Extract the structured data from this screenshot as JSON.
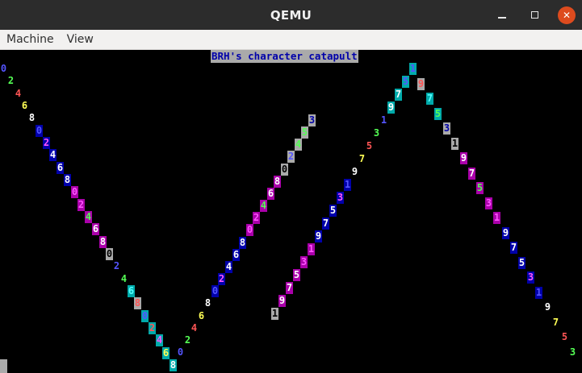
{
  "window": {
    "title": "QEMU",
    "controls": [
      "minimize-icon",
      "maximize-icon",
      "close-icon"
    ]
  },
  "menu": [
    "Machine",
    "View"
  ],
  "screen": {
    "banner": "BRH's character catapult",
    "palette": {
      "blue": "#5555ff",
      "green": "#55ff55",
      "red": "#ff5555",
      "yellow": "#ffff55",
      "white": "#ffffff",
      "darkblue_bg": "#0000aa",
      "magenta_bg": "#aa00aa",
      "cyan_bg": "#00aaaa",
      "gray_bg": "#aaaaaa",
      "magenta_fg": "#ff55ff",
      "cyan_fg": "#55ffff"
    },
    "glyphs": [
      {
        "c": "0",
        "fg": "#5555ff",
        "bg": ""
      },
      {
        "c": "2",
        "fg": "#55ff55",
        "bg": ""
      },
      {
        "c": "4",
        "fg": "#ff5555",
        "bg": ""
      },
      {
        "c": "6",
        "fg": "#ffff55",
        "bg": ""
      },
      {
        "c": "8",
        "fg": "#ffffff",
        "bg": ""
      },
      {
        "c": "0",
        "fg": "#5555ff",
        "bg": "#0000aa"
      },
      {
        "c": "2",
        "fg": "#ff55ff",
        "bg": "#0000aa"
      },
      {
        "c": "4",
        "fg": "#ffffff",
        "bg": "#0000aa"
      },
      {
        "c": "6",
        "fg": "#ffffff",
        "bg": "#0000aa"
      },
      {
        "c": "8",
        "fg": "#ffffff",
        "bg": "#0000aa"
      },
      {
        "c": "0",
        "fg": "#ff55ff",
        "bg": "#aa00aa"
      },
      {
        "c": "2",
        "fg": "#ff55ff",
        "bg": "#aa00aa"
      },
      {
        "c": "4",
        "fg": "#55ff55",
        "bg": "#aa00aa"
      },
      {
        "c": "6",
        "fg": "#ffffff",
        "bg": "#aa00aa"
      },
      {
        "c": "8",
        "fg": "#ffffff",
        "bg": "#aa00aa"
      },
      {
        "c": "0",
        "fg": "#000000",
        "bg": "#aaaaaa"
      },
      {
        "c": "2",
        "fg": "#5555ff",
        "bg": "#000000"
      },
      {
        "c": "4",
        "fg": "#55ff55",
        "bg": "#000000"
      },
      {
        "c": "6",
        "fg": "#55ffff",
        "bg": "#00aaaa"
      },
      {
        "c": "8",
        "fg": "#ff5555",
        "bg": "#aaaaaa"
      },
      {
        "c": "0",
        "fg": "#5555ff",
        "bg": "#00aaaa"
      },
      {
        "c": "2",
        "fg": "#ff5555",
        "bg": "#00aaaa"
      },
      {
        "c": "4",
        "fg": "#ff55ff",
        "bg": "#00aaaa"
      },
      {
        "c": "6",
        "fg": "#ffff55",
        "bg": "#00aaaa"
      },
      {
        "c": "8",
        "fg": "#ffffff",
        "bg": "#00aaaa"
      },
      {
        "c": "0",
        "fg": "#5555ff",
        "bg": ""
      },
      {
        "c": "2",
        "fg": "#55ff55",
        "bg": ""
      },
      {
        "c": "4",
        "fg": "#ff5555",
        "bg": ""
      },
      {
        "c": "6",
        "fg": "#ffff55",
        "bg": ""
      },
      {
        "c": "8",
        "fg": "#ffffff",
        "bg": ""
      },
      {
        "c": "0",
        "fg": "#5555ff",
        "bg": "#0000aa"
      },
      {
        "c": "2",
        "fg": "#ff55ff",
        "bg": "#0000aa"
      },
      {
        "c": "4",
        "fg": "#ffffff",
        "bg": "#0000aa"
      },
      {
        "c": "6",
        "fg": "#ffffff",
        "bg": "#0000aa"
      },
      {
        "c": "8",
        "fg": "#ffffff",
        "bg": "#0000aa"
      },
      {
        "c": "0",
        "fg": "#ff55ff",
        "bg": "#aa00aa"
      },
      {
        "c": "2",
        "fg": "#ff55ff",
        "bg": "#aa00aa"
      },
      {
        "c": "4",
        "fg": "#55ff55",
        "bg": "#aa00aa"
      },
      {
        "c": "6",
        "fg": "#ffffff",
        "bg": "#aa00aa"
      },
      {
        "c": "8",
        "fg": "#ffffff",
        "bg": "#aa00aa"
      },
      {
        "c": "0",
        "fg": "#000000",
        "bg": "#aaaaaa"
      },
      {
        "c": "2",
        "fg": "#5555ff",
        "bg": "#aaaaaa"
      },
      {
        "c": "4",
        "fg": "#55ff55",
        "bg": "#aaaaaa"
      },
      {
        "c": "5",
        "fg": "#55ff55",
        "bg": "#aaaaaa"
      },
      {
        "c": "3",
        "fg": "#0000aa",
        "bg": "#aaaaaa"
      },
      {
        "c": "1",
        "fg": "#000000",
        "bg": "#aaaaaa"
      },
      {
        "c": "9",
        "fg": "#ffffff",
        "bg": "#aa00aa"
      },
      {
        "c": "7",
        "fg": "#ffffff",
        "bg": "#aa00aa"
      },
      {
        "c": "5",
        "fg": "#ffffff",
        "bg": "#aa00aa"
      },
      {
        "c": "3",
        "fg": "#ff55ff",
        "bg": "#aa00aa"
      },
      {
        "c": "1",
        "fg": "#ff55ff",
        "bg": "#aa00aa"
      },
      {
        "c": "9",
        "fg": "#ffffff",
        "bg": "#0000aa"
      },
      {
        "c": "7",
        "fg": "#ffffff",
        "bg": "#0000aa"
      },
      {
        "c": "5",
        "fg": "#ffffff",
        "bg": "#0000aa"
      },
      {
        "c": "3",
        "fg": "#ff55ff",
        "bg": "#0000aa"
      },
      {
        "c": "1",
        "fg": "#5555ff",
        "bg": "#0000aa"
      },
      {
        "c": "9",
        "fg": "#ffffff",
        "bg": ""
      },
      {
        "c": "7",
        "fg": "#ffff55",
        "bg": ""
      },
      {
        "c": "5",
        "fg": "#ff5555",
        "bg": ""
      },
      {
        "c": "3",
        "fg": "#55ff55",
        "bg": ""
      },
      {
        "c": "1",
        "fg": "#5555ff",
        "bg": ""
      },
      {
        "c": "9",
        "fg": "#ffffff",
        "bg": "#00aaaa"
      },
      {
        "c": "7",
        "fg": "#ffffff",
        "bg": "#00aaaa"
      },
      {
        "c": "5",
        "fg": "#5555ff",
        "bg": "#00aaaa"
      },
      {
        "c": "3",
        "fg": "#ff5555",
        "bg": "#00aaaa"
      },
      {
        "c": "1",
        "fg": "#5555ff",
        "bg": "#00aaaa"
      },
      {
        "c": "9",
        "fg": "#ff5555",
        "bg": "#aaaaaa"
      },
      {
        "c": "7",
        "fg": "#55ffff",
        "bg": "#00aaaa"
      },
      {
        "c": "5",
        "fg": "#55ff55",
        "bg": "#00aaaa"
      },
      {
        "c": "3",
        "fg": "#0000aa",
        "bg": "#aaaaaa"
      },
      {
        "c": "1",
        "fg": "#000000",
        "bg": "#aaaaaa"
      },
      {
        "c": "9",
        "fg": "#ffffff",
        "bg": "#aa00aa"
      },
      {
        "c": "7",
        "fg": "#ffffff",
        "bg": "#aa00aa"
      },
      {
        "c": "5",
        "fg": "#55ff55",
        "bg": "#aa00aa"
      },
      {
        "c": "3",
        "fg": "#ff55ff",
        "bg": "#aa00aa"
      },
      {
        "c": "1",
        "fg": "#ff55ff",
        "bg": "#aa00aa"
      },
      {
        "c": "9",
        "fg": "#ffffff",
        "bg": "#0000aa"
      },
      {
        "c": "7",
        "fg": "#ffffff",
        "bg": "#0000aa"
      },
      {
        "c": "5",
        "fg": "#ffffff",
        "bg": "#0000aa"
      },
      {
        "c": "3",
        "fg": "#ff55ff",
        "bg": "#0000aa"
      },
      {
        "c": "1",
        "fg": "#5555ff",
        "bg": "#0000aa"
      },
      {
        "c": "9",
        "fg": "#ffffff",
        "bg": ""
      },
      {
        "c": "7",
        "fg": "#ffff55",
        "bg": ""
      },
      {
        "c": "5",
        "fg": "#ff5555",
        "bg": ""
      },
      {
        "c": "3",
        "fg": "#55ff55",
        "bg": ""
      },
      {
        "c": "1",
        "fg": "#5555ff",
        "bg": ""
      }
    ]
  }
}
